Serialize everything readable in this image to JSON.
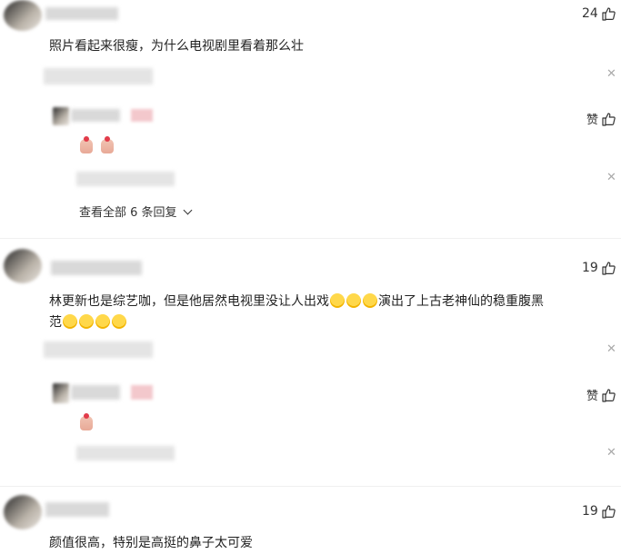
{
  "comments": [
    {
      "text": "照片看起来很瘦，为什么电视剧里看着那么壮",
      "likes": "24",
      "reply_more": "查看全部 6 条回复",
      "reply_like_label": "赞"
    },
    {
      "text_before": "林更新也是综艺咖，但是他居然电视里没让人出戏",
      "text_after": "演出了上古老神仙的稳重腹黑",
      "text_line2": "范",
      "likes": "19",
      "reply_like_label": "赞"
    },
    {
      "text": "颜值很高，特别是高挺的鼻子太可爱",
      "likes": "19"
    }
  ],
  "icons": {
    "like": "thumbs-up-icon",
    "close": "close-icon",
    "chevron": "chevron-down-icon",
    "emoji_smile": "smiling-face-icon",
    "emoji_laugh": "laughing-face-icon",
    "finger_heart": "finger-heart-icon"
  }
}
